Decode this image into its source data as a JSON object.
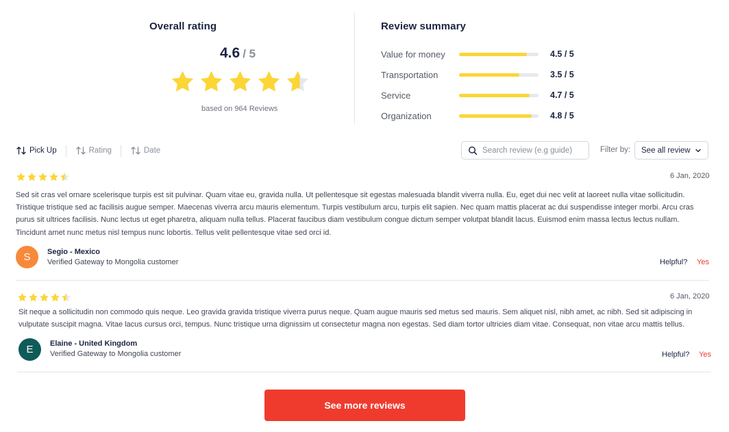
{
  "overall": {
    "title": "Overall rating",
    "score": "4.6",
    "out_of": "/ 5",
    "stars_value": 4.6,
    "based_on": "based on 964 Reviews"
  },
  "summary": {
    "title": "Review summary",
    "rows": [
      {
        "label": "Value for money",
        "value": "4.5 / 5",
        "fraction": 0.85
      },
      {
        "label": "Transportation",
        "value": "3.5 / 5",
        "fraction": 0.76
      },
      {
        "label": "Service",
        "value": "4.7 / 5",
        "fraction": 0.89
      },
      {
        "label": "Organization",
        "value": "4.8 / 5",
        "fraction": 0.91
      }
    ]
  },
  "sort": {
    "items": [
      "Pick Up",
      "Rating",
      "Date"
    ],
    "active": "Pick Up"
  },
  "search": {
    "placeholder": "Search review (e.g guide)"
  },
  "filter": {
    "label": "Filter by:",
    "selected": "See all review"
  },
  "reviews": [
    {
      "rating": 4.5,
      "date": "6 Jan, 2020",
      "text": "Sed sit cras vel ornare scelerisque turpis est sit pulvinar. Quam vitae eu, gravida nulla. Ut pellentesque sit egestas malesuada blandit viverra nulla. Eu, eget dui nec velit at laoreet nulla vitae sollicitudin. Tristique tristique sed ac facilisis augue semper. Maecenas viverra arcu mauris elementum. Turpis vestibulum arcu, turpis elit sapien. Nec quam mattis placerat ac dui suspendisse integer morbi. Arcu cras purus sit ultrices facilisis. Nunc lectus ut eget pharetra, aliquam nulla tellus. Placerat faucibus diam vestibulum congue dictum semper volutpat blandit lacus. Euismod enim massa lectus lectus nullam. Tincidunt amet nunc metus nisl tempus nunc lobortis. Tellus velit pellentesque vitae sed orci id.",
      "avatar_letter": "S",
      "avatar_color": "#f7893b",
      "name": "Segio - Mexico",
      "subtitle": "Verified Gateway to Mongolia customer",
      "helpful_label": "Helpful?",
      "yes_label": "Yes"
    },
    {
      "rating": 4.5,
      "date": "6 Jan, 2020",
      "text": "Sit neque a sollicitudin non commodo quis neque. Leo gravida gravida tristique viverra purus neque. Quam augue mauris sed metus sed mauris. Sem aliquet nisl, nibh amet, ac nibh. Sed sit adipiscing in vulputate suscipit magna. Vitae lacus cursus orci, tempus. Nunc tristique urna dignissim ut consectetur magna non egestas. Sed diam tortor ultricies diam vitae. Consequat, non vitae arcu mattis tellus.",
      "avatar_letter": "E",
      "avatar_color": "#0f5b5a",
      "name": "Elaine - United Kingdom",
      "subtitle": "Verified Gateway to Mongolia customer",
      "helpful_label": "Helpful?",
      "yes_label": "Yes"
    }
  ],
  "more_button": "See more reviews",
  "colors": {
    "star": "#fcd537",
    "star_empty": "#e7e8eb",
    "accent": "#ef3b2d",
    "text_dark": "#1b2440"
  }
}
